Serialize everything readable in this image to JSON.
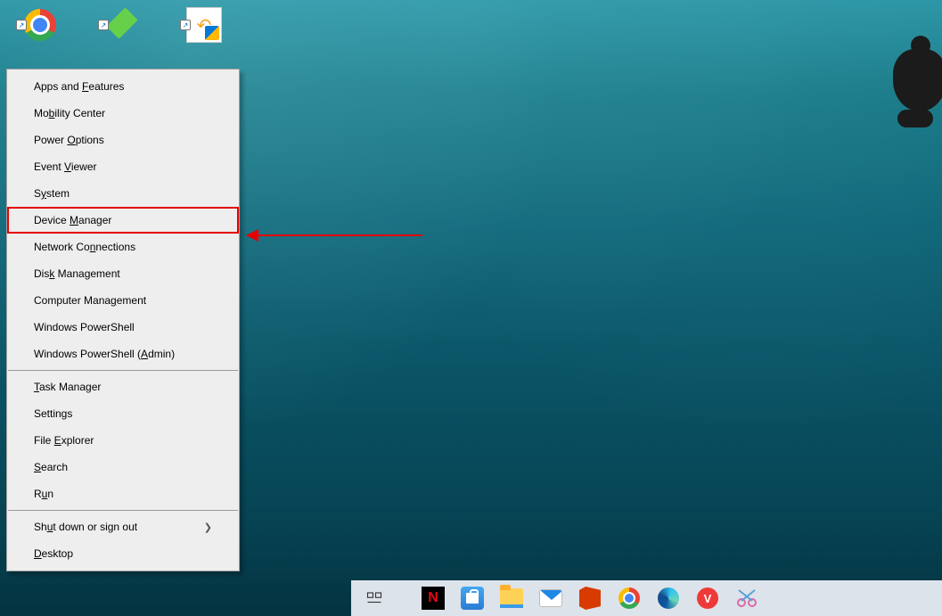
{
  "desktop": {
    "icons": [
      {
        "label": "Google Chrome",
        "name": "chrome-shortcut"
      },
      {
        "label": "The Sims",
        "name": "sims-shortcut"
      },
      {
        "label": "Stellar",
        "name": "stellar-shortcut"
      }
    ]
  },
  "winx": {
    "groups": [
      [
        {
          "pre": "Apps and ",
          "u": "F",
          "post": "eatures"
        },
        {
          "pre": "Mo",
          "u": "b",
          "post": "ility Center"
        },
        {
          "pre": "Power ",
          "u": "O",
          "post": "ptions"
        },
        {
          "pre": "Event ",
          "u": "V",
          "post": "iewer"
        },
        {
          "pre": "S",
          "u": "y",
          "post": "stem"
        },
        {
          "pre": "Device ",
          "u": "M",
          "post": "anager",
          "highlight": true
        },
        {
          "pre": "Network Co",
          "u": "n",
          "post": "nections"
        },
        {
          "pre": "Dis",
          "u": "k",
          "post": " Management"
        },
        {
          "pre": "Computer Mana",
          "u": "g",
          "post": "ement"
        },
        {
          "pre": "Windows PowerShell",
          "u": "",
          "post": ""
        },
        {
          "pre": "Windows PowerShell (",
          "u": "A",
          "post": "dmin)"
        }
      ],
      [
        {
          "pre": "",
          "u": "T",
          "post": "ask Manager"
        },
        {
          "pre": "Settings",
          "u": "",
          "post": ""
        },
        {
          "pre": "File ",
          "u": "E",
          "post": "xplorer"
        },
        {
          "pre": "",
          "u": "S",
          "post": "earch"
        },
        {
          "pre": "R",
          "u": "u",
          "post": "n"
        }
      ],
      [
        {
          "pre": "Sh",
          "u": "u",
          "post": "t down or sign out",
          "submenu": true
        },
        {
          "pre": "",
          "u": "D",
          "post": "esktop"
        }
      ]
    ]
  },
  "taskbar": {
    "items": [
      {
        "name": "task-view-button"
      },
      {
        "name": "netflix-app",
        "text": "N"
      },
      {
        "name": "microsoft-store-app"
      },
      {
        "name": "file-explorer-app"
      },
      {
        "name": "mail-app"
      },
      {
        "name": "office-app"
      },
      {
        "name": "chrome-app"
      },
      {
        "name": "edge-app"
      },
      {
        "name": "vivaldi-app"
      },
      {
        "name": "snip-sketch-app"
      }
    ]
  }
}
